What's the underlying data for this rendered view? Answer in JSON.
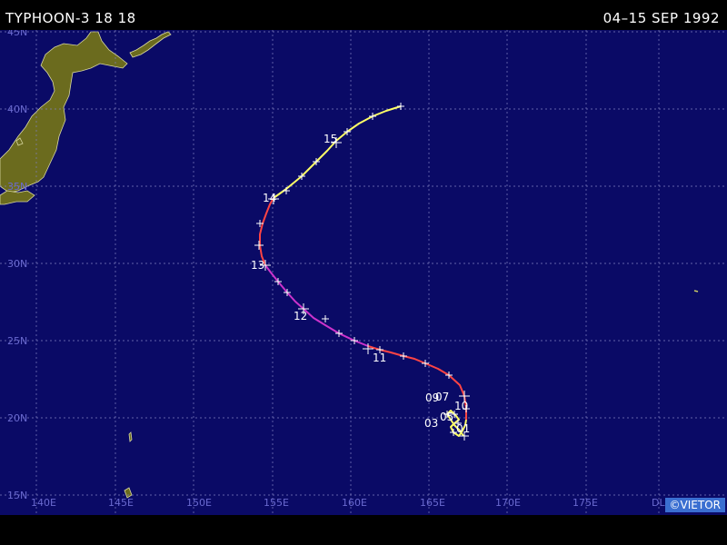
{
  "header": {
    "storm_title": "TYPHOON-3 18 18",
    "date_range": "04–15 SEP 1992"
  },
  "map": {
    "colors": {
      "ocean": "#0a0a66",
      "land": "#6b6b1e",
      "grid": "#8080c0",
      "axis_label": "#6a6ad0",
      "track_yellow": "#ffff66",
      "track_red": "#ff4444",
      "track_magenta": "#cc33cc",
      "day_label": "#ffffff"
    },
    "lat_labels": [
      "45N",
      "40N",
      "35N",
      "30N",
      "25N",
      "20N",
      "15N"
    ],
    "lon_labels": [
      "140E",
      "145E",
      "150E",
      "155E",
      "160E",
      "165E",
      "170E",
      "175E",
      "DL"
    ],
    "day_labels": [
      "15",
      "14",
      "13",
      "12",
      "11",
      "10",
      "09",
      "07",
      "05",
      "03",
      "01"
    ]
  },
  "footer": {
    "copyright": "©VIETOR"
  }
}
